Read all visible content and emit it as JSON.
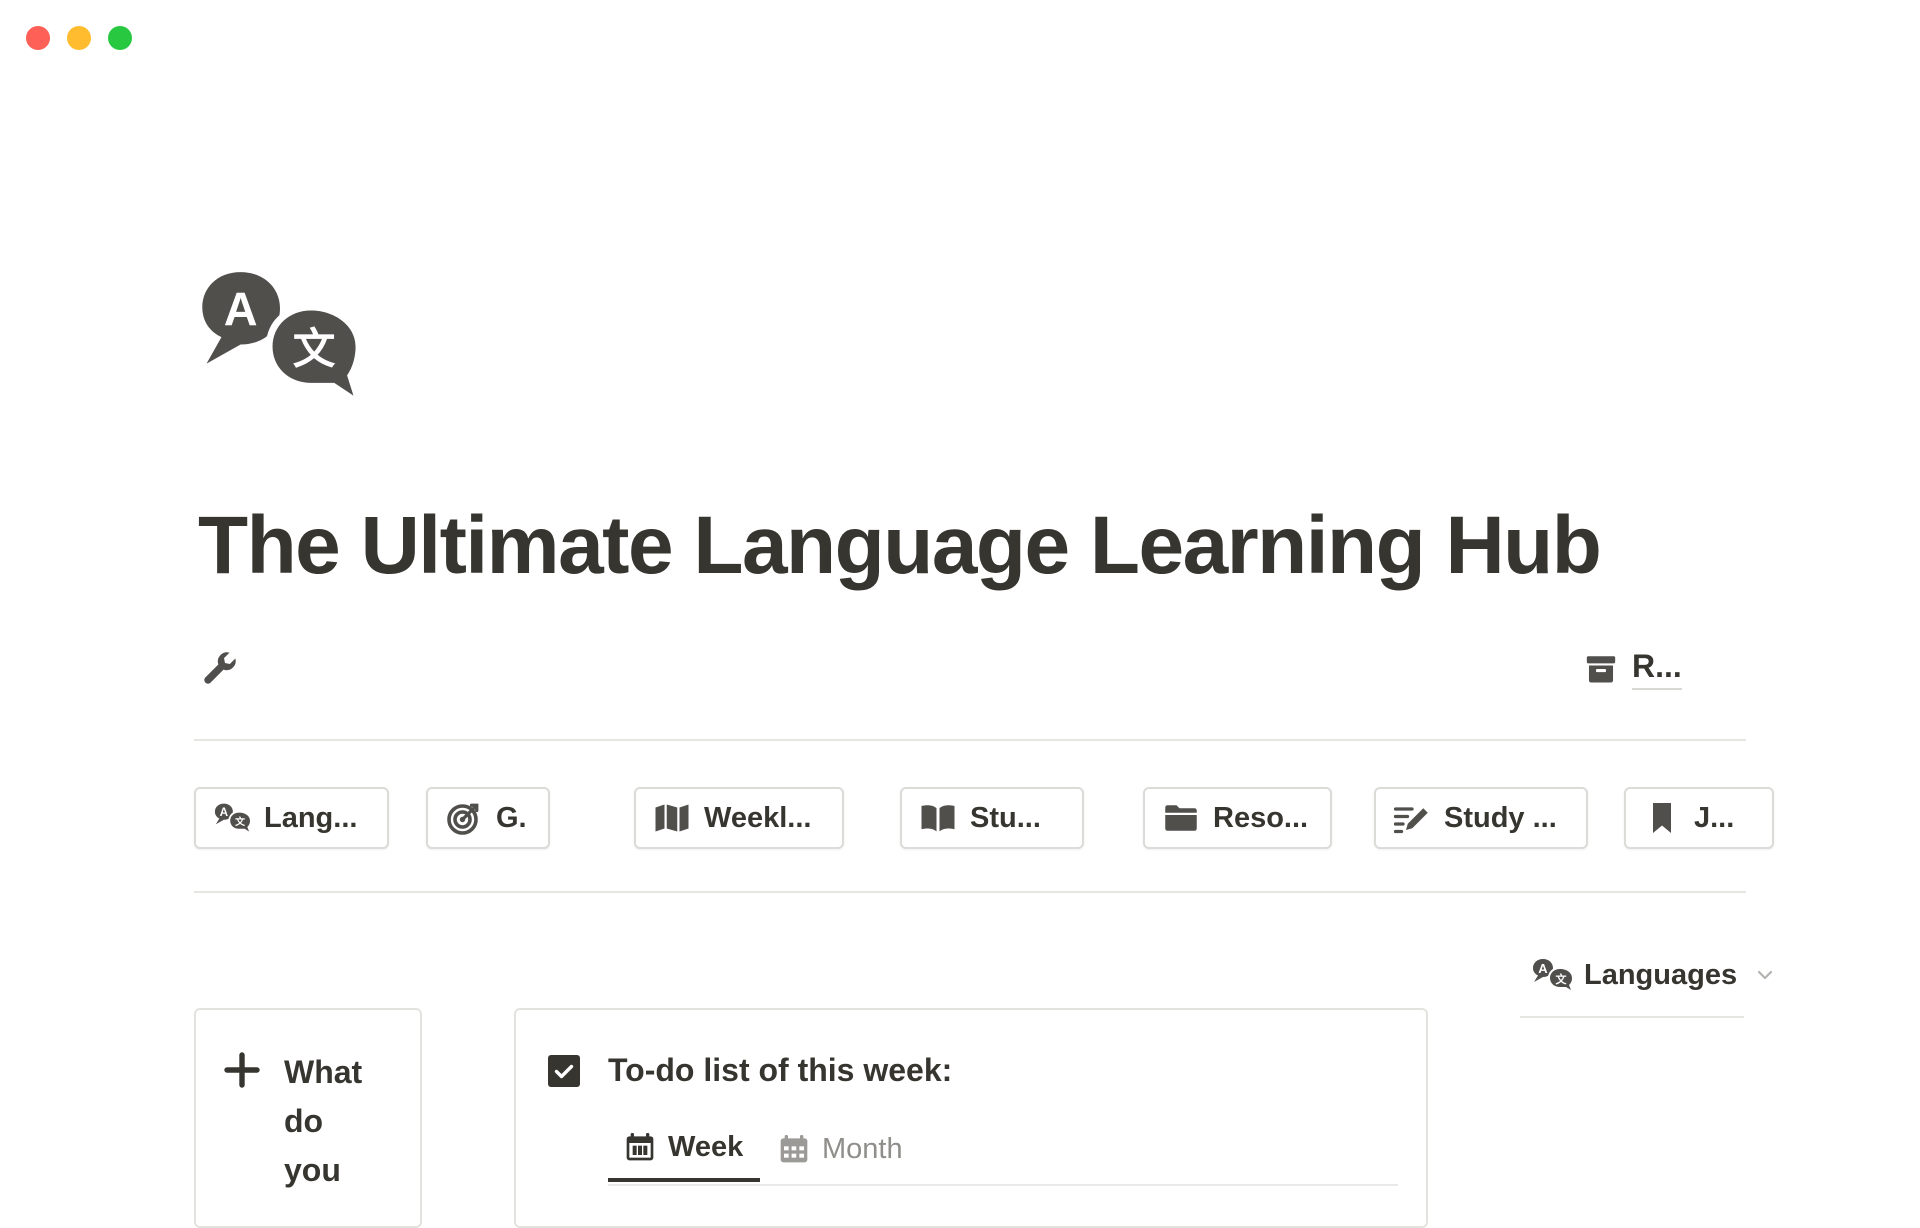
{
  "window": {
    "controls": [
      "close",
      "minimize",
      "zoom"
    ],
    "control_colors": {
      "close": "#fe5f57",
      "minimize": "#febc2e",
      "zoom": "#28c840"
    }
  },
  "page": {
    "icon": "language-translate-icon",
    "title": "The Ultimate Language Learning Hub",
    "settings_icon": "wrench-icon",
    "archive_link": {
      "icon": "archive-box-icon",
      "label": "R..."
    }
  },
  "nav_buttons": [
    {
      "icon": "language-translate-icon",
      "label": "Lang..."
    },
    {
      "icon": "target-icon",
      "label": "G."
    },
    {
      "icon": "map-icon",
      "label": "Weekl..."
    },
    {
      "icon": "open-book-icon",
      "label": "Stu..."
    },
    {
      "icon": "folder-icon",
      "label": "Reso..."
    },
    {
      "icon": "pencil-list-icon",
      "label": "Study ..."
    },
    {
      "icon": "bookmark-icon",
      "label": "J..."
    }
  ],
  "language_selector": {
    "icon": "language-translate-icon",
    "label": "Languages",
    "dropdown_icon": "chevron-down-icon"
  },
  "add_entry": {
    "icon": "plus-icon",
    "label": "What do you"
  },
  "todo": {
    "checked": true,
    "title": "To-do list of this week:",
    "tabs": [
      {
        "icon": "calendar-week-icon",
        "label": "Week",
        "active": true
      },
      {
        "icon": "calendar-month-icon",
        "label": "Month",
        "active": false
      }
    ]
  },
  "colors": {
    "text": "#37352f",
    "muted": "#8f8e8a",
    "border": "#dcdbd8",
    "divider": "#e6e5e2"
  }
}
